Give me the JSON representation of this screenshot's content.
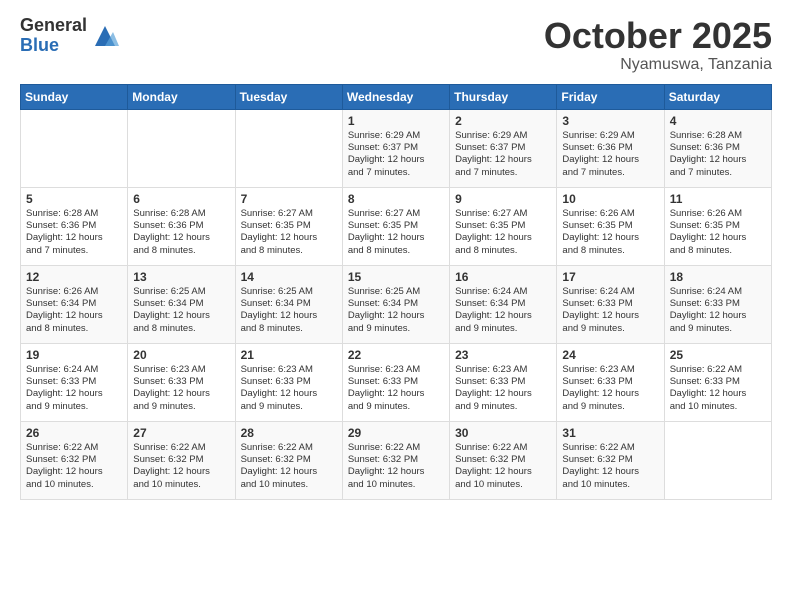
{
  "logo": {
    "general": "General",
    "blue": "Blue"
  },
  "header": {
    "month": "October 2025",
    "location": "Nyamuswa, Tanzania"
  },
  "weekdays": [
    "Sunday",
    "Monday",
    "Tuesday",
    "Wednesday",
    "Thursday",
    "Friday",
    "Saturday"
  ],
  "weeks": [
    [
      {
        "day": "",
        "info": ""
      },
      {
        "day": "",
        "info": ""
      },
      {
        "day": "",
        "info": ""
      },
      {
        "day": "1",
        "info": "Sunrise: 6:29 AM\nSunset: 6:37 PM\nDaylight: 12 hours\nand 7 minutes."
      },
      {
        "day": "2",
        "info": "Sunrise: 6:29 AM\nSunset: 6:37 PM\nDaylight: 12 hours\nand 7 minutes."
      },
      {
        "day": "3",
        "info": "Sunrise: 6:29 AM\nSunset: 6:36 PM\nDaylight: 12 hours\nand 7 minutes."
      },
      {
        "day": "4",
        "info": "Sunrise: 6:28 AM\nSunset: 6:36 PM\nDaylight: 12 hours\nand 7 minutes."
      }
    ],
    [
      {
        "day": "5",
        "info": "Sunrise: 6:28 AM\nSunset: 6:36 PM\nDaylight: 12 hours\nand 7 minutes."
      },
      {
        "day": "6",
        "info": "Sunrise: 6:28 AM\nSunset: 6:36 PM\nDaylight: 12 hours\nand 8 minutes."
      },
      {
        "day": "7",
        "info": "Sunrise: 6:27 AM\nSunset: 6:35 PM\nDaylight: 12 hours\nand 8 minutes."
      },
      {
        "day": "8",
        "info": "Sunrise: 6:27 AM\nSunset: 6:35 PM\nDaylight: 12 hours\nand 8 minutes."
      },
      {
        "day": "9",
        "info": "Sunrise: 6:27 AM\nSunset: 6:35 PM\nDaylight: 12 hours\nand 8 minutes."
      },
      {
        "day": "10",
        "info": "Sunrise: 6:26 AM\nSunset: 6:35 PM\nDaylight: 12 hours\nand 8 minutes."
      },
      {
        "day": "11",
        "info": "Sunrise: 6:26 AM\nSunset: 6:35 PM\nDaylight: 12 hours\nand 8 minutes."
      }
    ],
    [
      {
        "day": "12",
        "info": "Sunrise: 6:26 AM\nSunset: 6:34 PM\nDaylight: 12 hours\nand 8 minutes."
      },
      {
        "day": "13",
        "info": "Sunrise: 6:25 AM\nSunset: 6:34 PM\nDaylight: 12 hours\nand 8 minutes."
      },
      {
        "day": "14",
        "info": "Sunrise: 6:25 AM\nSunset: 6:34 PM\nDaylight: 12 hours\nand 8 minutes."
      },
      {
        "day": "15",
        "info": "Sunrise: 6:25 AM\nSunset: 6:34 PM\nDaylight: 12 hours\nand 9 minutes."
      },
      {
        "day": "16",
        "info": "Sunrise: 6:24 AM\nSunset: 6:34 PM\nDaylight: 12 hours\nand 9 minutes."
      },
      {
        "day": "17",
        "info": "Sunrise: 6:24 AM\nSunset: 6:33 PM\nDaylight: 12 hours\nand 9 minutes."
      },
      {
        "day": "18",
        "info": "Sunrise: 6:24 AM\nSunset: 6:33 PM\nDaylight: 12 hours\nand 9 minutes."
      }
    ],
    [
      {
        "day": "19",
        "info": "Sunrise: 6:24 AM\nSunset: 6:33 PM\nDaylight: 12 hours\nand 9 minutes."
      },
      {
        "day": "20",
        "info": "Sunrise: 6:23 AM\nSunset: 6:33 PM\nDaylight: 12 hours\nand 9 minutes."
      },
      {
        "day": "21",
        "info": "Sunrise: 6:23 AM\nSunset: 6:33 PM\nDaylight: 12 hours\nand 9 minutes."
      },
      {
        "day": "22",
        "info": "Sunrise: 6:23 AM\nSunset: 6:33 PM\nDaylight: 12 hours\nand 9 minutes."
      },
      {
        "day": "23",
        "info": "Sunrise: 6:23 AM\nSunset: 6:33 PM\nDaylight: 12 hours\nand 9 minutes."
      },
      {
        "day": "24",
        "info": "Sunrise: 6:23 AM\nSunset: 6:33 PM\nDaylight: 12 hours\nand 9 minutes."
      },
      {
        "day": "25",
        "info": "Sunrise: 6:22 AM\nSunset: 6:33 PM\nDaylight: 12 hours\nand 10 minutes."
      }
    ],
    [
      {
        "day": "26",
        "info": "Sunrise: 6:22 AM\nSunset: 6:32 PM\nDaylight: 12 hours\nand 10 minutes."
      },
      {
        "day": "27",
        "info": "Sunrise: 6:22 AM\nSunset: 6:32 PM\nDaylight: 12 hours\nand 10 minutes."
      },
      {
        "day": "28",
        "info": "Sunrise: 6:22 AM\nSunset: 6:32 PM\nDaylight: 12 hours\nand 10 minutes."
      },
      {
        "day": "29",
        "info": "Sunrise: 6:22 AM\nSunset: 6:32 PM\nDaylight: 12 hours\nand 10 minutes."
      },
      {
        "day": "30",
        "info": "Sunrise: 6:22 AM\nSunset: 6:32 PM\nDaylight: 12 hours\nand 10 minutes."
      },
      {
        "day": "31",
        "info": "Sunrise: 6:22 AM\nSunset: 6:32 PM\nDaylight: 12 hours\nand 10 minutes."
      },
      {
        "day": "",
        "info": ""
      }
    ]
  ]
}
